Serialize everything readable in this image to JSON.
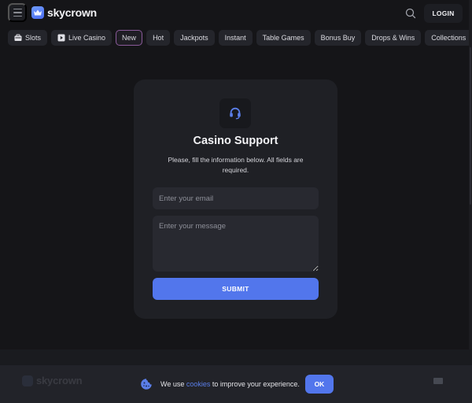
{
  "header": {
    "brand": "skycrown",
    "login_label": "LOGIN",
    "icons": {
      "menu": "hamburger-icon",
      "search": "search-icon",
      "logo": "crown-icon"
    }
  },
  "categories": [
    {
      "label": "Slots",
      "icon": "slot-machine-icon",
      "active": false
    },
    {
      "label": "Live Casino",
      "icon": "play-icon",
      "active": false
    },
    {
      "label": "New",
      "active": true
    },
    {
      "label": "Hot",
      "active": false
    },
    {
      "label": "Jackpots",
      "active": false
    },
    {
      "label": "Instant",
      "active": false
    },
    {
      "label": "Table Games",
      "active": false
    },
    {
      "label": "Bonus Buy",
      "active": false
    },
    {
      "label": "Drops & Wins",
      "active": false
    },
    {
      "label": "Collections",
      "active": false
    }
  ],
  "support_form": {
    "icon": "headset-icon",
    "title": "Casino Support",
    "subtitle": "Please, fill the information below. All fields are required.",
    "email_placeholder": "Enter your email",
    "email_value": "",
    "message_placeholder": "Enter your message",
    "message_value": "",
    "submit_label": "SUBMIT"
  },
  "cookie_banner": {
    "text_before": "We use ",
    "link_text": "cookies",
    "text_after": " to improve your experience.",
    "ok_label": "OK",
    "icon": "cookie-icon"
  },
  "footer": {
    "brand": "skycrown"
  },
  "colors": {
    "accent": "#5276ec",
    "background": "#151518",
    "card": "#1f2025",
    "link": "#5b7fea"
  }
}
